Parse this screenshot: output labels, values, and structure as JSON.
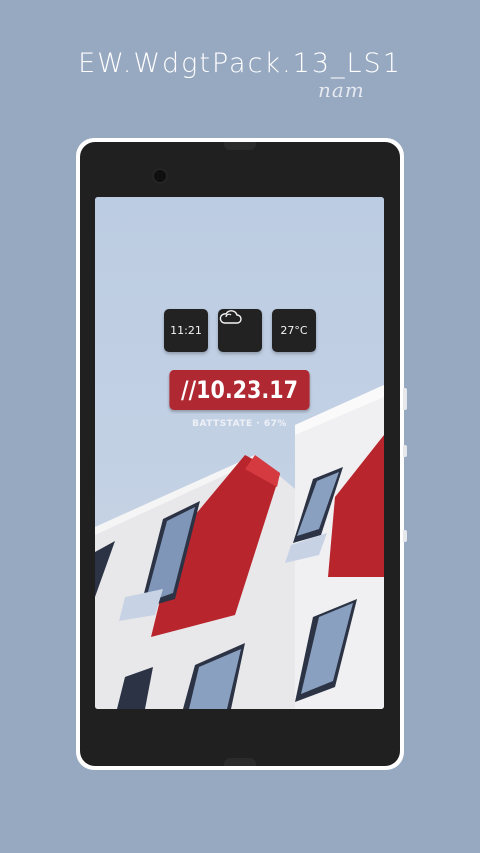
{
  "header": {
    "title": "EW.WdgtPack.13_LS1",
    "signature": "nam"
  },
  "widget": {
    "time": "11:21",
    "weather_icon": "cloud-icon",
    "temperature": "27°C",
    "date": "//10.23.17",
    "battery_label": "BATTSTATE · 67%"
  },
  "colors": {
    "background": "#97a8c1",
    "accent_red": "#b02832",
    "tile_dark": "#222222",
    "phone_body": "#202020"
  }
}
